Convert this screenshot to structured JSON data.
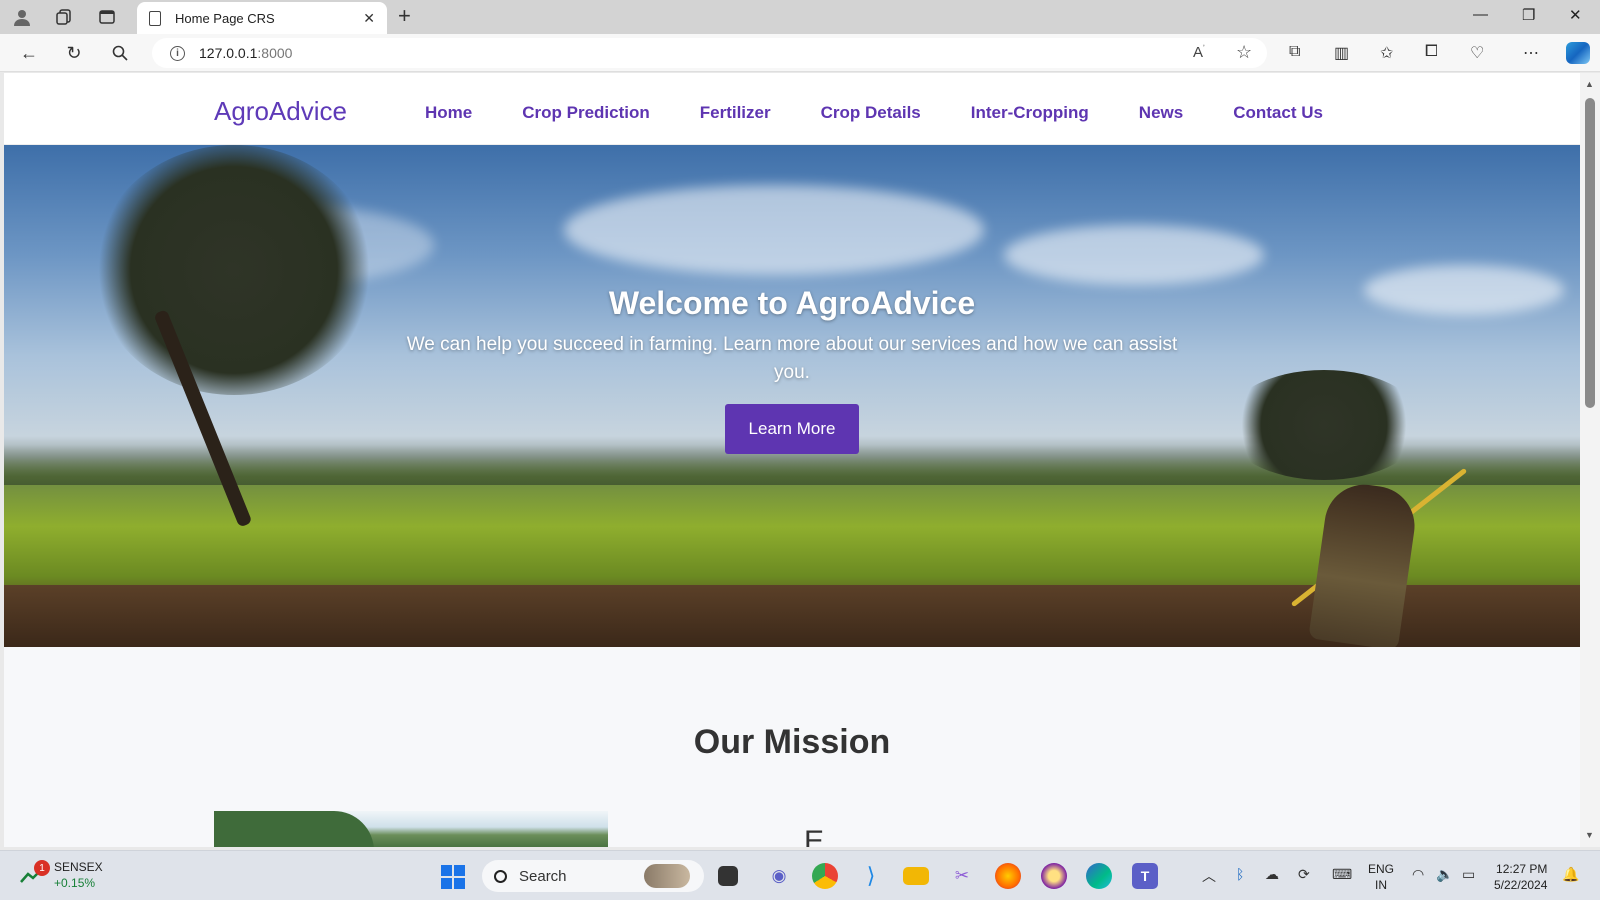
{
  "browser": {
    "tab_title": "Home Page CRS",
    "url_host": "127.0.0.1",
    "url_port": ":8000"
  },
  "site": {
    "brand": "AgroAdvice",
    "menu": [
      {
        "label": "Home"
      },
      {
        "label": "Crop Prediction"
      },
      {
        "label": "Fertilizer"
      },
      {
        "label": "Crop Details"
      },
      {
        "label": "Inter-Cropping"
      },
      {
        "label": "News"
      },
      {
        "label": "Contact Us"
      }
    ],
    "hero": {
      "title": "Welcome to AgroAdvice",
      "subtitle": "We can help you succeed in farming. Learn more about our services and how we can assist you.",
      "button": "Learn More"
    },
    "mission": {
      "title": "Our Mission",
      "partial_heading": "E                   ...                    "
    }
  },
  "taskbar": {
    "widget_name": "SENSEX",
    "widget_change": "+0.15%",
    "widget_badge": "1",
    "search_label": "Search",
    "lang_top": "ENG",
    "lang_bottom": "IN",
    "time": "12:27 PM",
    "date": "5/22/2024"
  },
  "colors": {
    "accent": "#5e35b1",
    "nav_bg": "#ffffff"
  }
}
